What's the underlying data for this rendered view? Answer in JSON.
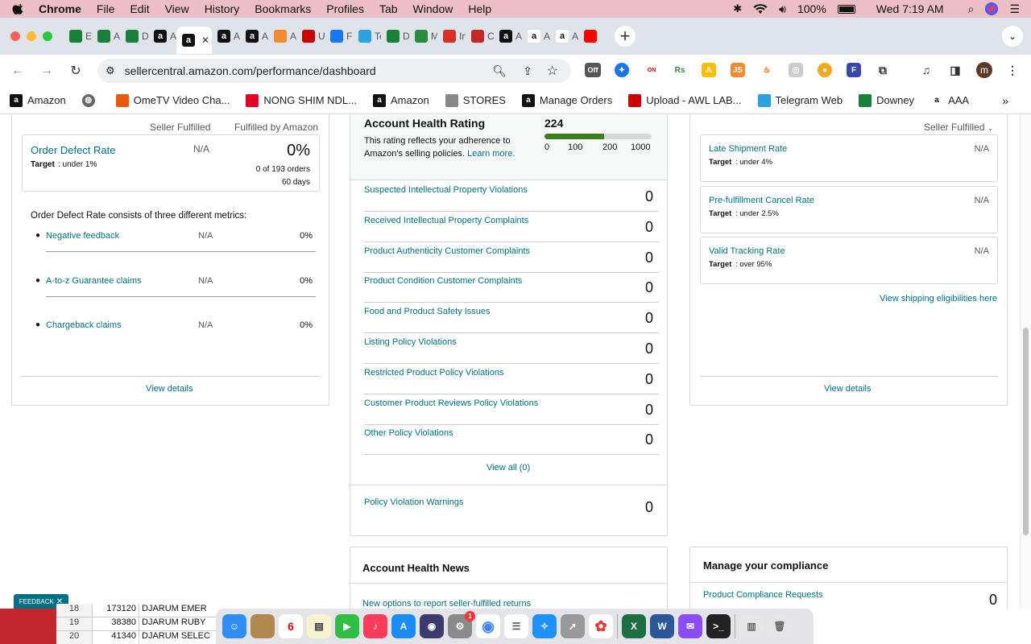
{
  "menubar": {
    "app": "Chrome",
    "items": [
      "File",
      "Edit",
      "View",
      "History",
      "Bookmarks",
      "Profiles",
      "Tab",
      "Window",
      "Help"
    ],
    "battery": "100%",
    "clock": "Wed 7:19 AM"
  },
  "tabs": [
    {
      "label": "E",
      "icon": "sheets-icon",
      "color": "#188038"
    },
    {
      "label": "A",
      "icon": "sheets-icon",
      "color": "#188038"
    },
    {
      "label": "D",
      "icon": "sheets-icon",
      "color": "#188038"
    },
    {
      "label": "A",
      "icon": "amazon-icon",
      "color": "#111"
    },
    {
      "label": "",
      "icon": "amazon-icon",
      "color": "#111",
      "active": true
    },
    {
      "label": "A",
      "icon": "amazon-icon",
      "color": "#111"
    },
    {
      "label": "A",
      "icon": "amazon-icon",
      "color": "#111"
    },
    {
      "label": "A",
      "icon": "pen-icon",
      "color": "#f28b30"
    },
    {
      "label": "U",
      "icon": "upload-icon",
      "color": "#c00"
    },
    {
      "label": "Fa",
      "icon": "facebook-icon",
      "color": "#1877f2"
    },
    {
      "label": "Te",
      "icon": "telegram-icon",
      "color": "#2aa3e0"
    },
    {
      "label": "D",
      "icon": "sheets-icon",
      "color": "#188038"
    },
    {
      "label": "M",
      "icon": "m-icon",
      "color": "#2b8a3e"
    },
    {
      "label": "In",
      "icon": "gmail-icon",
      "color": "#d93025"
    },
    {
      "label": "Cl",
      "icon": "cloud-icon",
      "color": "#c62828"
    },
    {
      "label": "A",
      "icon": "amazon-icon",
      "color": "#111"
    },
    {
      "label": "A",
      "icon": "amazon-a-icon",
      "color": "#fff"
    },
    {
      "label": "A",
      "icon": "amazon-a-icon",
      "color": "#fff"
    },
    {
      "label": "",
      "icon": "youtube-icon",
      "color": "#ff0000"
    }
  ],
  "url": "sellercentral.amazon.com/performance/dashboard",
  "profile_initial": "m",
  "ext_off": "Off",
  "bookmarks": [
    {
      "label": "Amazon",
      "icon": "amazon-icon"
    },
    {
      "label": "",
      "icon": "globe-icon"
    },
    {
      "label": "OmeTV Video Cha...",
      "icon": "ometv-icon"
    },
    {
      "label": "NONG SHIM NDL...",
      "icon": "pinterest-icon"
    },
    {
      "label": "Amazon",
      "icon": "amazon-icon"
    },
    {
      "label": "STORES",
      "icon": "folder-icon"
    },
    {
      "label": "Manage Orders",
      "icon": "amazon-icon"
    },
    {
      "label": "Upload - AWL LAB...",
      "icon": "upload-icon"
    },
    {
      "label": "Telegram Web",
      "icon": "telegram-icon"
    },
    {
      "label": "Downey",
      "icon": "sheets-icon"
    },
    {
      "label": "AAA",
      "icon": "amazon-a-icon"
    }
  ],
  "odr_card": {
    "col_seller": "Seller Fulfilled",
    "col_fba": "Fulfilled by Amazon",
    "title": "Order Defect Rate",
    "target_label": "Target",
    "target": ": under 1%",
    "seller_value": "N/A",
    "fba_value": "0%",
    "orders": "0 of 193 orders",
    "days": "60 days",
    "consists": "Order Defect Rate consists of three different metrics:",
    "metrics": [
      {
        "name": "Negative feedback",
        "seller": "N/A",
        "fba": "0%"
      },
      {
        "name": "A-to-z Guarantee claims",
        "seller": "N/A",
        "fba": "0%"
      },
      {
        "name": "Chargeback claims",
        "seller": "N/A",
        "fba": "0%"
      }
    ],
    "view_details": "View details"
  },
  "ahr_card": {
    "title": "Account Health Rating",
    "score": "224",
    "desc": "This rating reflects your adherence to Amazon's selling policies.",
    "learn_more": "Learn more.",
    "scale": [
      "0",
      "100",
      "200",
      "1000"
    ],
    "score_fraction": 0.56,
    "violations": [
      {
        "name": "Suspected Intellectual Property Violations",
        "count": "0"
      },
      {
        "name": "Received Intellectual Property Complaints",
        "count": "0"
      },
      {
        "name": "Product Authenticity Customer Complaints",
        "count": "0"
      },
      {
        "name": "Product Condition Customer Complaints",
        "count": "0"
      },
      {
        "name": "Food and Product Safety Issues",
        "count": "0"
      },
      {
        "name": "Listing Policy Violations",
        "count": "0"
      },
      {
        "name": "Restricted Product Policy Violations",
        "count": "0"
      },
      {
        "name": "Customer Product Reviews Policy Violations",
        "count": "0"
      },
      {
        "name": "Other Policy Violations",
        "count": "0"
      }
    ],
    "view_all": "View all (0)",
    "warnings_label": "Policy Violation Warnings",
    "warnings_count": "0"
  },
  "shipping_card": {
    "dropdown": "Seller Fulfilled",
    "metrics": [
      {
        "name": "Late Shipment Rate",
        "target_label": "Target",
        "target": ": under 4%",
        "value": "N/A"
      },
      {
        "name": "Pre-fulfillment Cancel Rate",
        "target_label": "Target",
        "target": ": under 2.5%",
        "value": "N/A"
      },
      {
        "name": "Valid Tracking Rate",
        "target_label": "Target",
        "target": ": over 95%",
        "value": "N/A"
      }
    ],
    "eligibilities": "View shipping eligibilities here",
    "view_details": "View details"
  },
  "news_card": {
    "title": "Account Health News",
    "item": "New options to report seller-fulfilled returns"
  },
  "compliance_card": {
    "title": "Manage your compliance",
    "item": "Product Compliance Requests",
    "count": "0"
  },
  "feedback": "FEEDBACK",
  "sheet_rows": [
    {
      "row": "18",
      "num": "173120",
      "name": "DJARUM EMER"
    },
    {
      "row": "19",
      "num": "38380",
      "name": "DJARUM RUBY"
    },
    {
      "row": "20",
      "num": "41340",
      "name": "DJARUM SELEC"
    }
  ],
  "dock_calendar_day": "6",
  "dock_badge": "1"
}
